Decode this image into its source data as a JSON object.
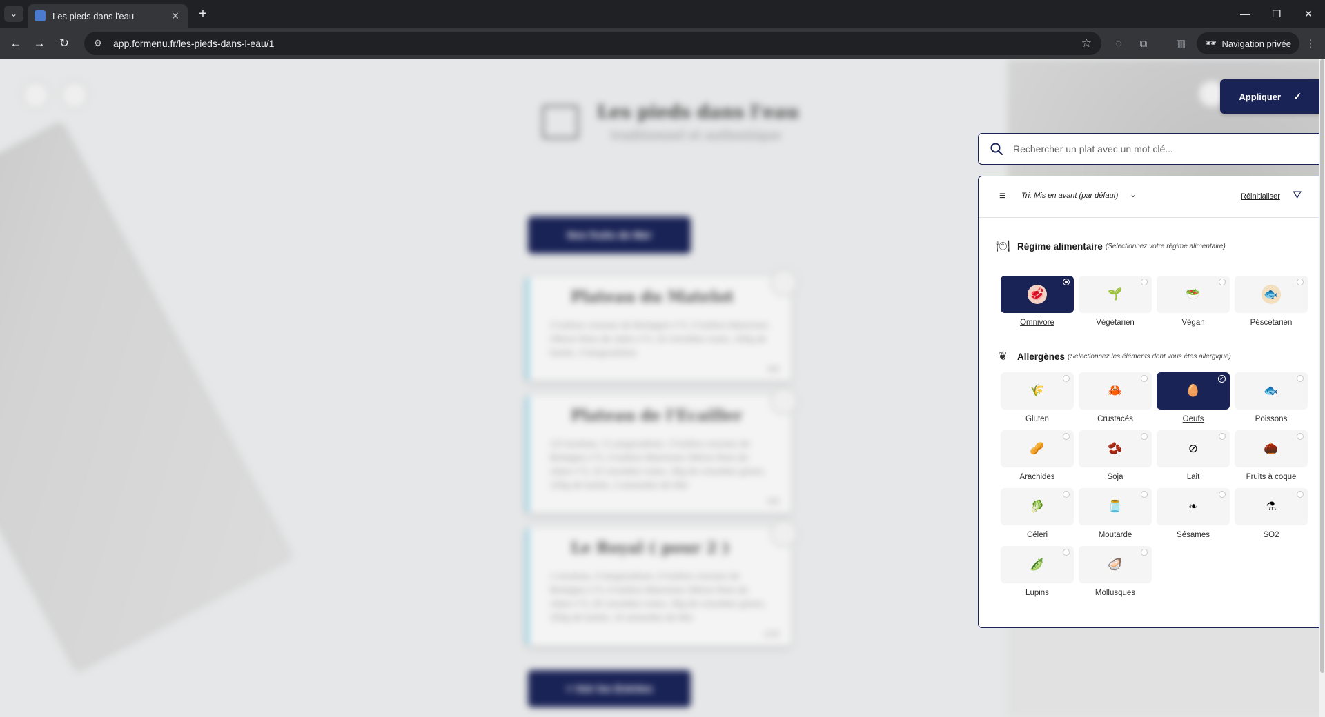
{
  "browser": {
    "tab_title": "Les pieds dans l'eau",
    "url": "app.formenu.fr/les-pieds-dans-l-eau/1",
    "incognito_label": "Navigation privée"
  },
  "restaurant": {
    "name": "Les pieds dans l'eau",
    "tagline": "traditionnel et authentique"
  },
  "menu": {
    "category_button": "Nos fruits de Mer",
    "back_button": "< Voir les Entrées",
    "dishes": [
      {
        "title": "Plateau du Matelot",
        "desc": "3 huîtres creuses de Bretagne n°3, 3 huîtres Marennes Oléron fines de claire n°3, 10 crevettes roses, 100g de bulots, 3 langoustines",
        "price": "35€"
      },
      {
        "title": "Plateau de l'Ecailler",
        "desc": "1/2 tourteau, 3 Langoustines, 3 huîtres creuses de Bretagne n°3, 3 huîtres Marennes Oléron fines de claire n°3, 10 crevettes roses, 30g de crevettes grises, 100g de bulots, 3 amandes de Mer",
        "price": "55€"
      },
      {
        "title": "Le Royal ( pour 2 )",
        "desc": "1 tourteau, 6 langoustines, 6 huîtres creuses de Bretagne n°3, 6 huîtres Marennes Oléron fines de claire n°3, 20 crevettes roses, 30g de crevettes grises, 200g de bulots, 10 amandes de Mer",
        "price": "115€"
      }
    ]
  },
  "filters": {
    "apply_label": "Appliquer",
    "search_placeholder": "Rechercher un plat avec un mot clé...",
    "sort_label": "Tri: Mis en avant (par défaut)",
    "reset_label": "Réinitialiser",
    "diet": {
      "title": "Régime alimentaire",
      "hint": "(Selectionnez votre régime alimentaire)",
      "options": [
        {
          "label": "Omnivore",
          "icon": "meat-veg-icon",
          "selected": true
        },
        {
          "label": "Végétarien",
          "icon": "sprout-icon",
          "selected": false
        },
        {
          "label": "Végan",
          "icon": "vegan-icon",
          "selected": false
        },
        {
          "label": "Péscétarien",
          "icon": "fish-icon",
          "selected": false
        }
      ]
    },
    "allergens": {
      "title": "Allergènes",
      "hint": "(Selectionnez les éléments dont vous êtes allergique)",
      "options": [
        {
          "label": "Gluten",
          "icon": "wheat-icon",
          "selected": false
        },
        {
          "label": "Crustacés",
          "icon": "crab-icon",
          "selected": false
        },
        {
          "label": "Oeufs",
          "icon": "egg-icon",
          "selected": true
        },
        {
          "label": "Poissons",
          "icon": "fish-icon",
          "selected": false
        },
        {
          "label": "Arachides",
          "icon": "peanut-icon",
          "selected": false
        },
        {
          "label": "Soja",
          "icon": "soy-icon",
          "selected": false
        },
        {
          "label": "Lait",
          "icon": "no-milk-icon",
          "selected": false
        },
        {
          "label": "Fruits à coque",
          "icon": "nut-icon",
          "selected": false
        },
        {
          "label": "Céleri",
          "icon": "celery-icon",
          "selected": false
        },
        {
          "label": "Moutarde",
          "icon": "mustard-icon",
          "selected": false
        },
        {
          "label": "Sésames",
          "icon": "sesame-icon",
          "selected": false
        },
        {
          "label": "SO2",
          "icon": "flask-icon",
          "selected": false
        },
        {
          "label": "Lupins",
          "icon": "lupin-icon",
          "selected": false
        },
        {
          "label": "Mollusques",
          "icon": "shellfish-icon",
          "selected": false
        }
      ]
    }
  },
  "colors": {
    "navy": "#1a2356",
    "accent_blue": "#8fd0e4"
  }
}
